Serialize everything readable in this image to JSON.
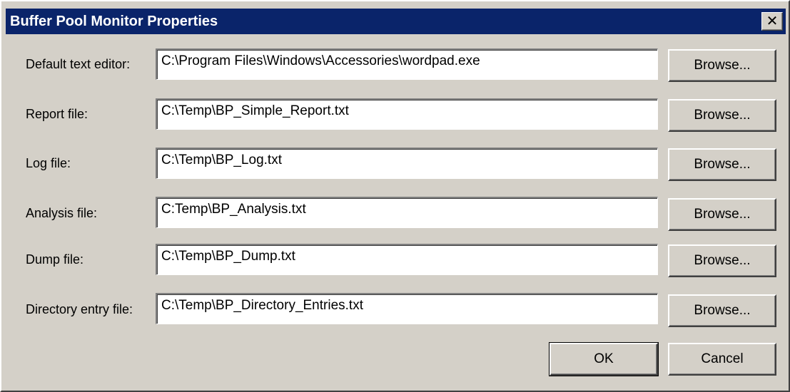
{
  "window": {
    "title": "Buffer Pool Monitor Properties",
    "close_glyph": "✕"
  },
  "fields": [
    {
      "label": "Default text editor:",
      "value": "C:\\Program Files\\Windows\\Accessories\\wordpad.exe",
      "button": "Browse..."
    },
    {
      "label": "Report file:",
      "value": "C:\\Temp\\BP_Simple_Report.txt",
      "button": "Browse..."
    },
    {
      "label": "Log file:",
      "value": "C:\\Temp\\BP_Log.txt",
      "button": "Browse..."
    },
    {
      "label": "Analysis file:",
      "value": "C:Temp\\BP_Analysis.txt",
      "button": "Browse..."
    },
    {
      "label": "Dump file:",
      "value": "C:\\Temp\\BP_Dump.txt",
      "button": "Browse..."
    },
    {
      "label": "Directory entry file:",
      "value": "C:\\Temp\\BP_Directory_Entries.txt",
      "button": "Browse..."
    }
  ],
  "footer": {
    "ok_label": "OK",
    "cancel_label": "Cancel"
  },
  "colors": {
    "titlebar": "#0a246a",
    "face": "#d4d0c8"
  }
}
